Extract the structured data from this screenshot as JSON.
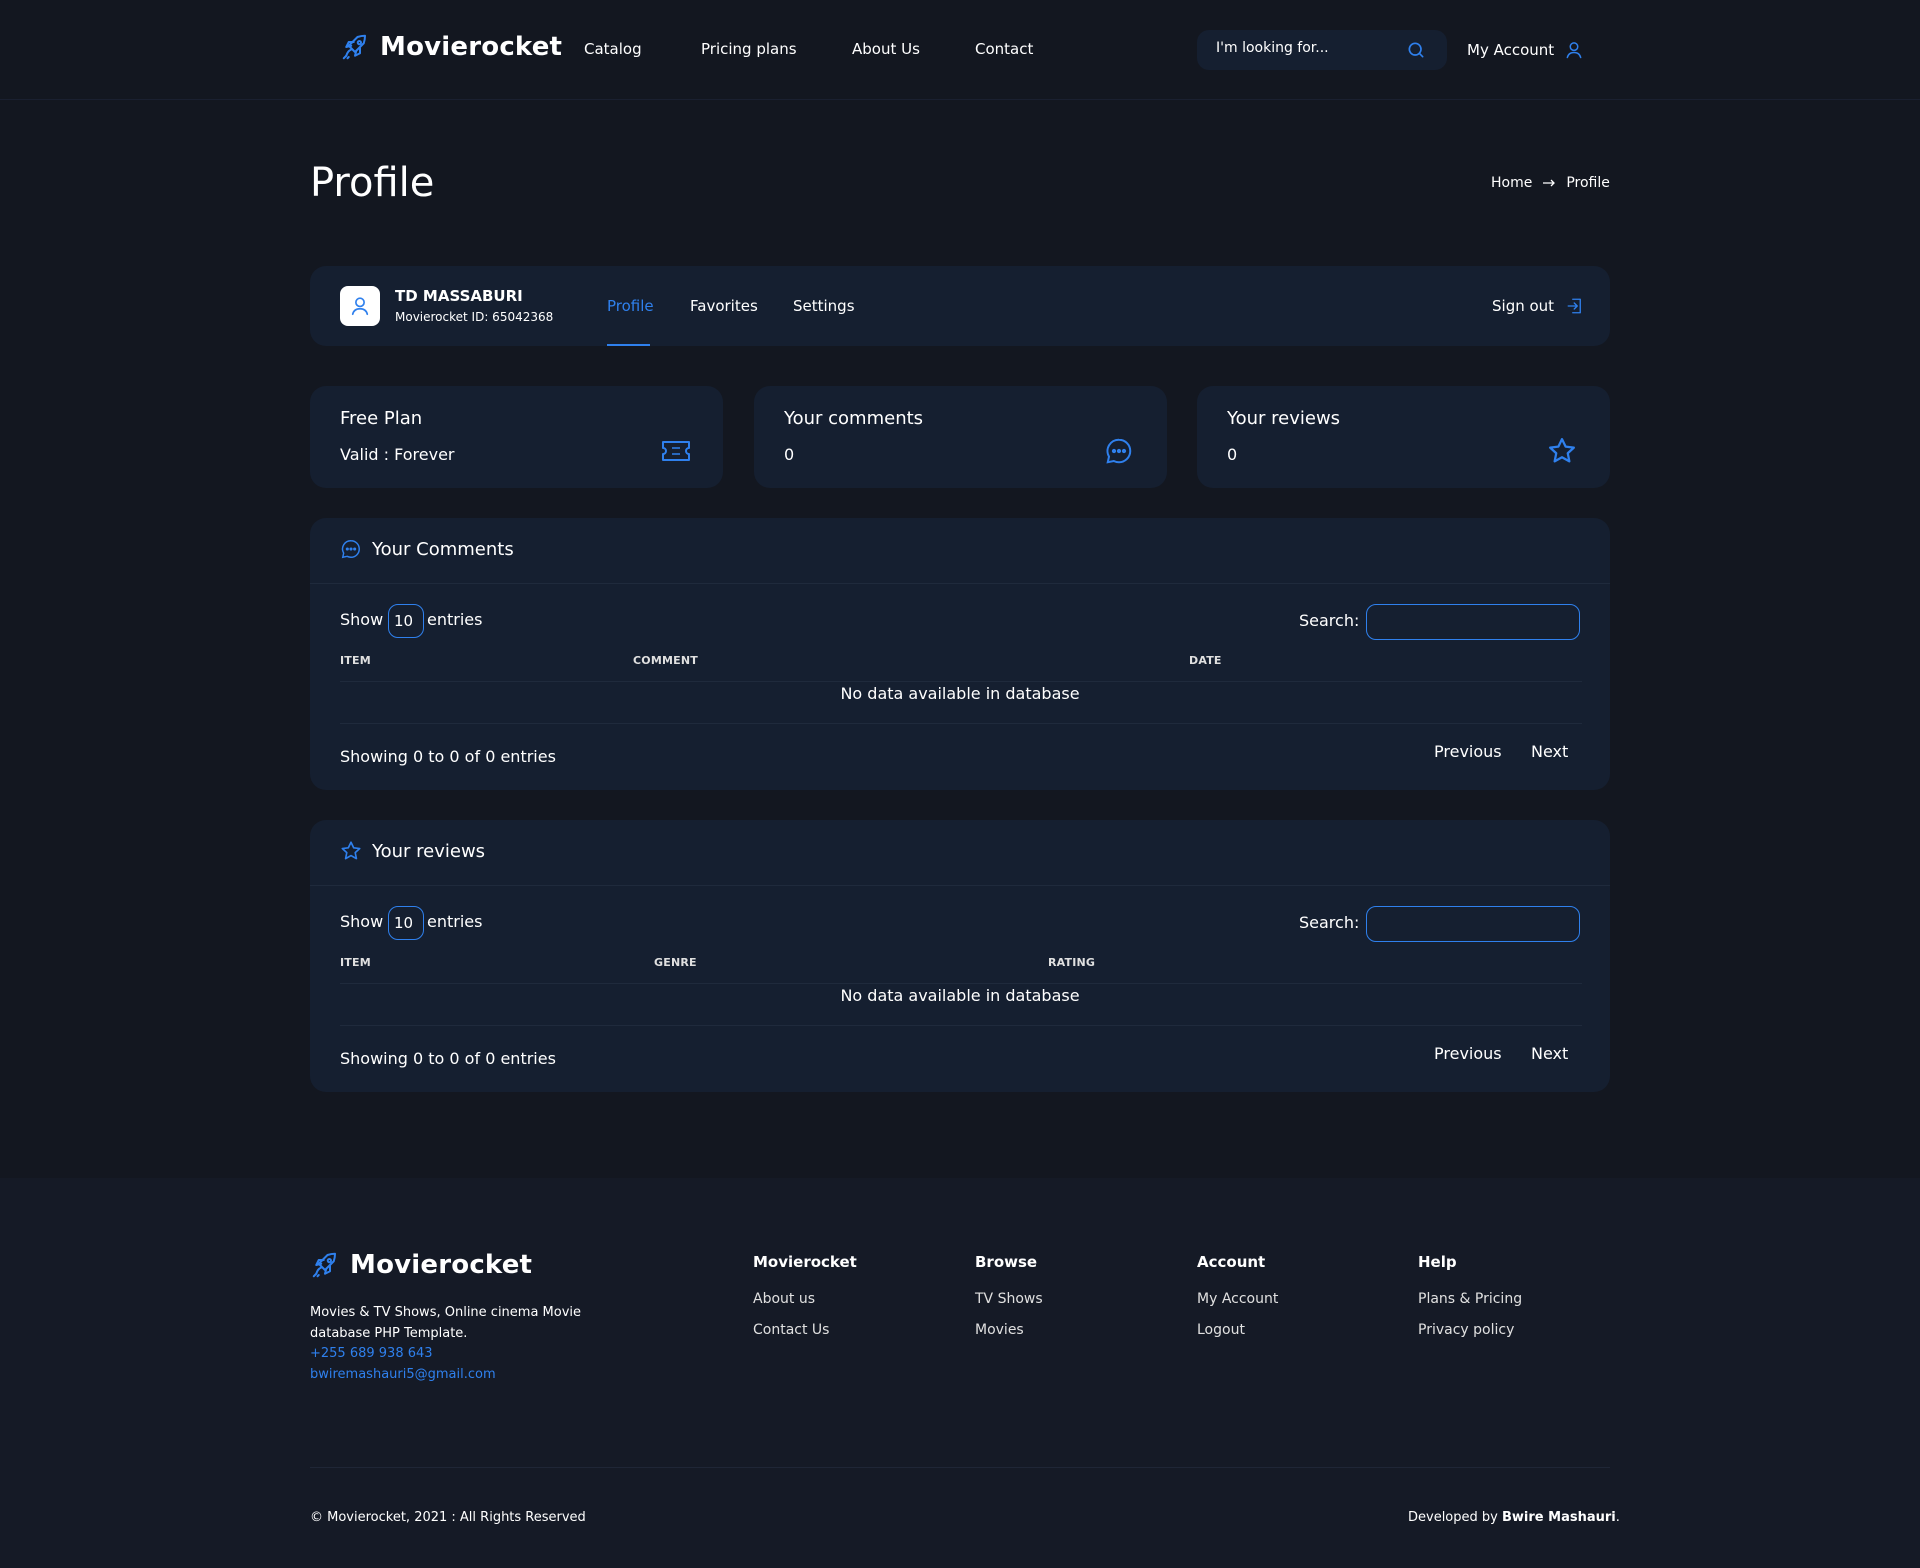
{
  "header": {
    "logo": "Movierocket",
    "nav": [
      "Catalog",
      "Pricing plans",
      "About Us",
      "Contact"
    ],
    "search_placeholder": "I'm looking for...",
    "account_label": "My Account"
  },
  "page": {
    "title": "Profile",
    "breadcrumb": {
      "home": "Home",
      "current": "Profile"
    }
  },
  "profile": {
    "name": "TD MASSABURI",
    "id_line": "Movierocket ID: 65042368",
    "tabs": [
      "Profile",
      "Favorites",
      "Settings"
    ],
    "active_tab": "Profile",
    "sign_out": "Sign out"
  },
  "stats": [
    {
      "title": "Free Plan",
      "value": "Valid : Forever",
      "icon": "ticket-icon"
    },
    {
      "title": "Your comments",
      "value": "0",
      "icon": "chat-bubble-icon"
    },
    {
      "title": "Your reviews",
      "value": "0",
      "icon": "star-icon"
    }
  ],
  "comments_section": {
    "title": "Your Comments",
    "show_label": "Show",
    "show_value": "10",
    "entries_label": "entries",
    "search_label": "Search:",
    "columns": [
      "ITEM",
      "COMMENT",
      "DATE"
    ],
    "empty_text": "No data available in database",
    "info": "Showing 0 to 0 of 0 entries",
    "previous": "Previous",
    "next": "Next"
  },
  "reviews_section": {
    "title": "Your reviews",
    "show_label": "Show",
    "show_value": "10",
    "entries_label": "entries",
    "search_label": "Search:",
    "columns": [
      "ITEM",
      "GENRE",
      "RATING"
    ],
    "empty_text": "No data available in database",
    "info": "Showing 0 to 0 of 0 entries",
    "previous": "Previous",
    "next": "Next"
  },
  "footer": {
    "logo": "Movierocket",
    "description": "Movies & TV Shows, Online cinema Movie database PHP Template.",
    "phone": "+255 689 938 643",
    "email": "bwiremashauri5@gmail.com",
    "columns": [
      {
        "title": "Movierocket",
        "links": [
          "About us",
          "Contact Us"
        ]
      },
      {
        "title": "Browse",
        "links": [
          "TV Shows",
          "Movies"
        ]
      },
      {
        "title": "Account",
        "links": [
          "My Account",
          "Logout"
        ]
      },
      {
        "title": "Help",
        "links": [
          "Plans & Pricing",
          "Privacy policy"
        ]
      }
    ],
    "copyright": "© Movierocket, 2021 : All Rights Reserved",
    "developed_by": "Developed by",
    "developer": "Bwire Mashauri",
    "developer_suffix": "."
  },
  "colors": {
    "background": "#131720",
    "panel": "#151f30",
    "accent": "#2f80ed"
  }
}
